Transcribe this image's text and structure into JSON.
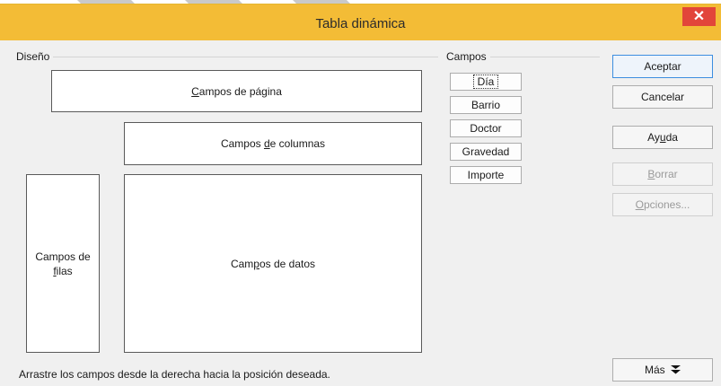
{
  "window": {
    "title": "Tabla dinámica",
    "close_glyph": "✕"
  },
  "layout_group": {
    "label": "Diseño"
  },
  "zones": {
    "page": {
      "pre": "",
      "key": "C",
      "post": "ampos de página"
    },
    "columns": {
      "pre": "Campos ",
      "key": "d",
      "post": "e columnas"
    },
    "rows_line1": "Campos de",
    "rows": {
      "pre": "",
      "key": "f",
      "post": "ilas"
    },
    "data": {
      "pre": "Cam",
      "key": "p",
      "post": "os de datos"
    }
  },
  "fields_group": {
    "label": "Campos",
    "items": [
      "Día",
      "Barrio",
      "Doctor",
      "Gravedad",
      "Importe"
    ],
    "selected": "Día"
  },
  "buttons": {
    "accept": "Aceptar",
    "cancel": "Cancelar",
    "help": {
      "pre": "Ay",
      "key": "u",
      "post": "da"
    },
    "delete": {
      "pre": "",
      "key": "B",
      "post": "orrar"
    },
    "options": {
      "pre": "",
      "key": "O",
      "post": "pciones..."
    },
    "more": "Más",
    "more_icon": "double-chevron-down-icon"
  },
  "hint": "Arrastre los campos desde la derecha hacia la posición deseada.",
  "colors": {
    "titlebar": "#f3bc36",
    "close": "#e2453a",
    "default_border": "#3c8ee0"
  }
}
